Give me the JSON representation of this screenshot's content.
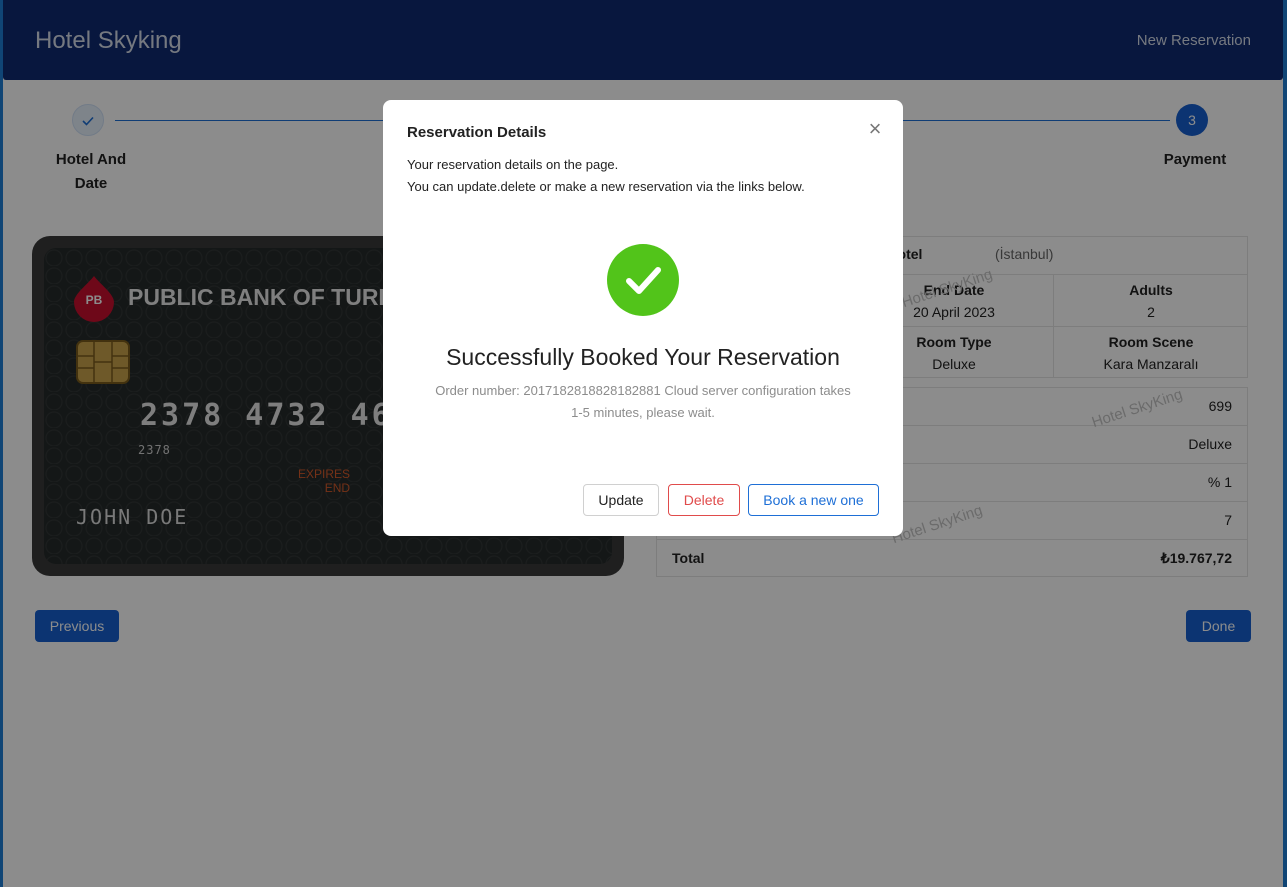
{
  "header": {
    "brand": "Hotel Skyking",
    "nav_link": "New Reservation"
  },
  "stepper": {
    "steps": [
      {
        "label_line1": "Hotel And",
        "label_line2": "Date",
        "status": "done"
      },
      {
        "number": "3",
        "label": "Payment",
        "status": "active"
      }
    ],
    "done_icon": "check-icon"
  },
  "card": {
    "bank_initials": "PB",
    "bank_name": "PUBLIC BANK OF TURK",
    "number": "2378 4732 467",
    "number_small": "2378",
    "expires_line1": "EXPIRES",
    "expires_line2": "END",
    "holder": "JOHN DOE"
  },
  "summary": {
    "hotel_name": "nbul Hotel",
    "hotel_city": "(İstanbul)",
    "end_date_label": "End Date",
    "end_date_value": "20 April 2023",
    "adults_label": "Adults",
    "adults_value": "2",
    "room_type_label": "Room Type",
    "room_type_value": "Deluxe",
    "room_scene_label": "Room Scene",
    "room_scene_value": "Kara Manzaralı"
  },
  "pricing": {
    "rows": [
      "699",
      "Deluxe",
      "% 1",
      "7"
    ],
    "total_label": "Total",
    "total_value": "₺19.767,72"
  },
  "watermark": "Hotel SkyKing",
  "buttons": {
    "previous": "Previous",
    "done": "Done"
  },
  "modal": {
    "title": "Reservation Details",
    "close": "×",
    "desc_line1": "Your reservation details on the page.",
    "desc_line2": "You can update.delete or make a new reservation via the links below.",
    "success_title": "Successfully Booked Your Reservation",
    "success_sub": "Order number: 2017182818828182881 Cloud server configuration takes 1-5 minutes, please wait.",
    "update": "Update",
    "delete": "Delete",
    "book_new": "Book a new one"
  },
  "colors": {
    "header": "#0f2a72",
    "primary": "#1760d0",
    "success": "#52c41a",
    "danger": "#e04b4b"
  }
}
